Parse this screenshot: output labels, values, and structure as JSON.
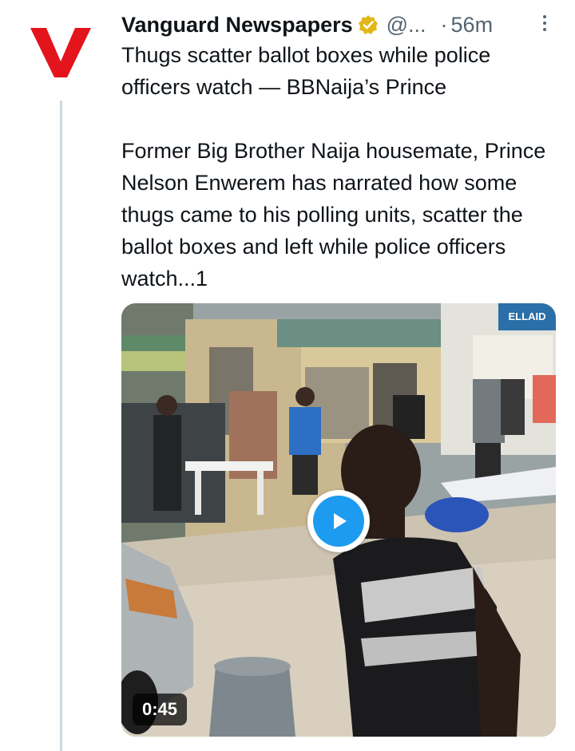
{
  "tweet": {
    "author": "Vanguard Newspapers",
    "handle": "@...",
    "separator": "·",
    "time": "56m",
    "headline": "Thugs scatter ballot boxes while police officers watch — BBNaija’s Prince",
    "body": "Former Big Brother Naija housemate, Prince Nelson Enwerem has narrated how some thugs came to his polling units, scatter the ballot boxes and left while police officers watch...1",
    "avatar_letter": "V",
    "media": {
      "type": "video",
      "duration": "0:45",
      "sign_text": "ELLAID"
    }
  },
  "colors": {
    "accent": "#1d9bf0",
    "avatar_red": "#e3141b",
    "verified_gold": "#e2b719",
    "muted": "#536471"
  },
  "icons": {
    "verified": "verified-badge-icon",
    "more": "more-options-icon",
    "play": "play-icon"
  }
}
